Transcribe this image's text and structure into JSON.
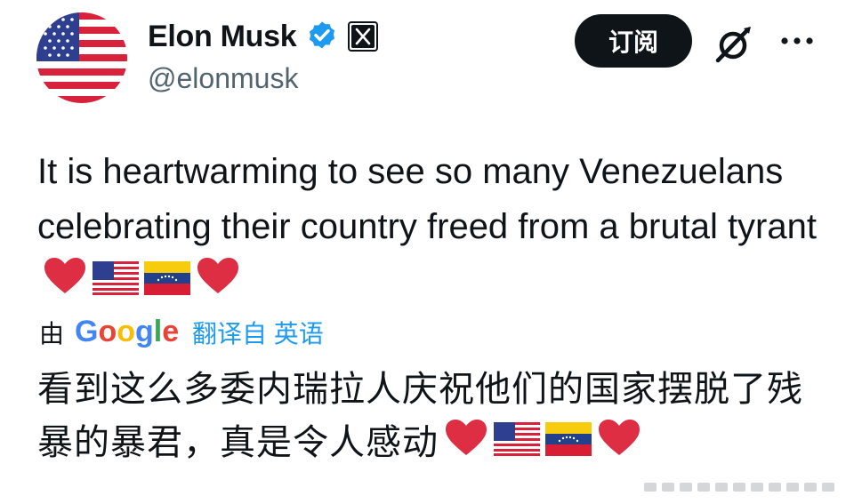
{
  "author": {
    "name": "Elon Musk",
    "handle": "@elonmusk",
    "avatar_icon": "us-flag-avatar",
    "verified_color": "#1d9bf0"
  },
  "actions": {
    "subscribe_label": "订阅",
    "grok_icon": "grok-icon",
    "more_icon": "more-icon"
  },
  "tweet": {
    "text": "It is heartwarming to see so many Venezuelans celebrating their country freed from a brutal tyrant",
    "emojis": [
      "red-heart",
      "us-flag",
      "venezuela-flag",
      "red-heart"
    ]
  },
  "translation": {
    "by": "由",
    "provider": "Google",
    "link_text": "翻译自 英语",
    "text": "看到这么多委内瑞拉人庆祝他们的国家摆脱了残暴的暴君，真是令人感动"
  },
  "colors": {
    "accent": "#1d9bf0",
    "button_bg": "#0f1419",
    "text": "#0f1419",
    "secondary_text": "#536471"
  }
}
